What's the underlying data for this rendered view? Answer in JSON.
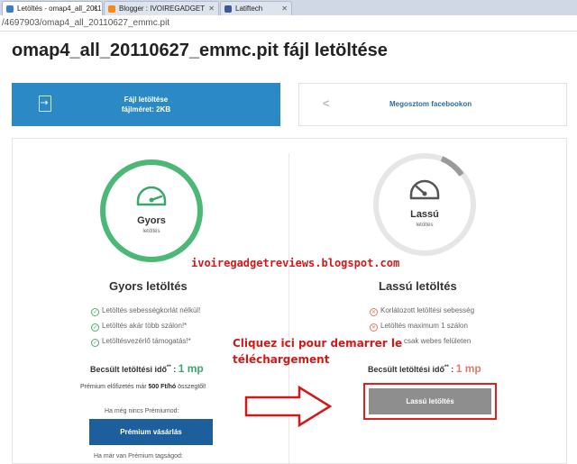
{
  "browser": {
    "tabs": [
      {
        "label": "Letöltés - omap4_all_2011"
      },
      {
        "label": "Blogger : IVOIREGADGET"
      },
      {
        "label": "Latiftech"
      }
    ],
    "address": "/4697903/omap4_all_20110627_emmc.pit"
  },
  "page": {
    "title": "omap4_all_20110627_emmc.pit fájl letöltése"
  },
  "download_button": {
    "line1": "Fájl letöltése",
    "line2": "fájlméret: 2KB"
  },
  "share_button": {
    "label": "Megosztom facebookon"
  },
  "fast": {
    "gauge_name": "Gyors",
    "gauge_sub": "letöltés",
    "title": "Gyors letöltés",
    "features": [
      "Letöltés sebességkorlát nélkül!",
      "Letöltés akár több szálon!*",
      "Letöltésvezérlő támogatás!*"
    ],
    "est_label": "Becsült letöltési idő",
    "est_sup": "**",
    "est_sep": " : ",
    "est_value": "1 mp",
    "premium_note_prefix": "Prémium előfizetés már ",
    "premium_note_price": "500 Ft/hó",
    "premium_note_suffix": " összegtől!",
    "no_premium": "Ha még nincs Prémiumod:",
    "button": "Prémium vásárlás",
    "has_premium": "Ha már van Prémium tagságod:"
  },
  "slow": {
    "gauge_name": "Lassú",
    "gauge_sub": "letöltés",
    "title": "Lassú letöltés",
    "features": [
      "Korlátozott letöltési sebesség",
      "Letöltés maximum 1 szálon",
      "csak webes felületen"
    ],
    "est_label": "Becsült letöltési idő",
    "est_sup": "**",
    "est_sep": " : ",
    "est_value": "1 mp",
    "button": "Lassú letöltés"
  },
  "overlay": {
    "watermark": "ivoiregadgetreviews.blogspot.com",
    "annotation_line1": "Cliquez ici pour demarrer le",
    "annotation_line2": "téléchargement"
  },
  "colors": {
    "primary_blue": "#2b8ac6",
    "premium_blue": "#1d5f9c",
    "fast_green": "#3aa86a",
    "slow_red": "#e27a6a",
    "annotation_red": "#d41818"
  }
}
